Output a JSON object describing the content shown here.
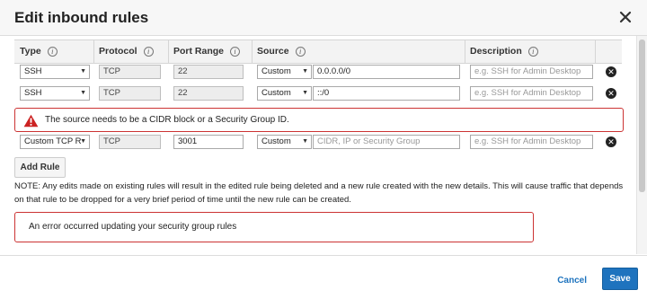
{
  "dialog": {
    "title": "Edit inbound rules"
  },
  "table": {
    "headers": {
      "type": "Type",
      "protocol": "Protocol",
      "port_range": "Port Range",
      "source": "Source",
      "description": "Description"
    },
    "info_glyph": "i",
    "rows": [
      {
        "type": "SSH",
        "protocol": "TCP",
        "port_range": "22",
        "source_type": "Custom",
        "source_value": "0.0.0.0/0",
        "description_placeholder": "e.g. SSH for Admin Desktop"
      },
      {
        "type": "SSH",
        "protocol": "TCP",
        "port_range": "22",
        "source_type": "Custom",
        "source_value": "::/0",
        "description_placeholder": "e.g. SSH for Admin Desktop"
      },
      {
        "type": "Custom TCP R",
        "protocol": "TCP",
        "port_range": "3001",
        "source_type": "Custom",
        "source_placeholder": "CIDR, IP or Security Group",
        "description_placeholder": "e.g. SSH for Admin Desktop"
      }
    ],
    "validation_error": "The source needs to be a CIDR block or a Security Group ID."
  },
  "add_rule_label": "Add Rule",
  "note": "NOTE: Any edits made on existing rules will result in the edited rule being deleted and a new rule created with the new details. This will cause traffic that depends on that rule to be dropped for a very brief period of time until the new rule can be created.",
  "update_error": "An error occurred updating your security group rules",
  "footer": {
    "cancel_label": "Cancel",
    "save_label": "Save"
  },
  "colors": {
    "accent": "#1e73be",
    "error_border": "#cc3333",
    "warning_icon": "#cc2222"
  },
  "icons": {
    "close": "close-icon",
    "info": "info-icon",
    "warning": "warning-icon",
    "remove": "remove-rule-icon",
    "dropdown": "chevron-down-icon"
  }
}
